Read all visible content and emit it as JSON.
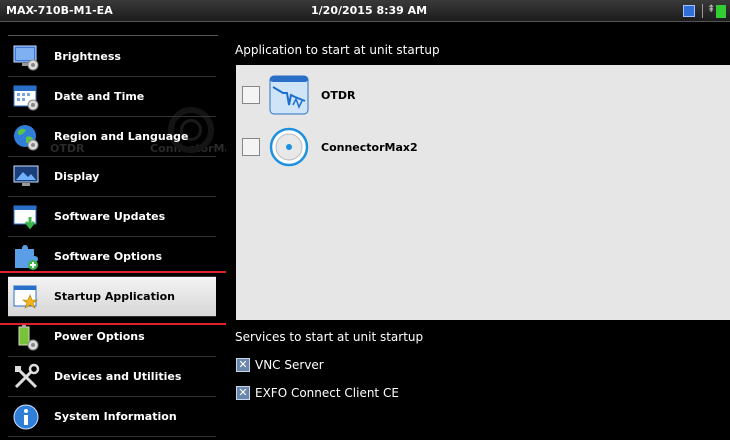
{
  "titlebar": {
    "device": "MAX-710B-M1-EA",
    "datetime": "1/20/2015 8:39 AM",
    "tray_icons": [
      "window-icon",
      "plug-icon",
      "battery-icon"
    ]
  },
  "sidebar": {
    "background_ghost": [
      "OTDR",
      "ConnectorMax2"
    ],
    "items": [
      {
        "label": "Brightness",
        "icon": "monitor-icon"
      },
      {
        "label": "Date and Time",
        "icon": "calendar-icon"
      },
      {
        "label": "Region and Language",
        "icon": "globe-icon"
      },
      {
        "label": "Display",
        "icon": "display-icon"
      },
      {
        "label": "Software Updates",
        "icon": "update-icon"
      },
      {
        "label": "Software Options",
        "icon": "puzzle-icon"
      },
      {
        "label": "Startup Application",
        "icon": "star-window-icon",
        "selected": true
      },
      {
        "label": "Power Options",
        "icon": "power-options-icon"
      },
      {
        "label": "Devices and Utilities",
        "icon": "tools-icon"
      },
      {
        "label": "System Information",
        "icon": "info-icon"
      }
    ]
  },
  "main": {
    "apps_title": "Application to start at unit startup",
    "apps": [
      {
        "name": "OTDR",
        "checked": false,
        "icon": "otdr-icon"
      },
      {
        "name": "ConnectorMax2",
        "checked": false,
        "icon": "connector-icon"
      }
    ],
    "services_title": "Services to start at unit startup",
    "services": [
      {
        "name": "VNC Server",
        "checked": true
      },
      {
        "name": "EXFO Connect Client CE",
        "checked": true
      }
    ]
  },
  "colors": {
    "highlight": "#e0202a",
    "accent_blue": "#1e90e0",
    "panel": "#e6e6e6"
  }
}
